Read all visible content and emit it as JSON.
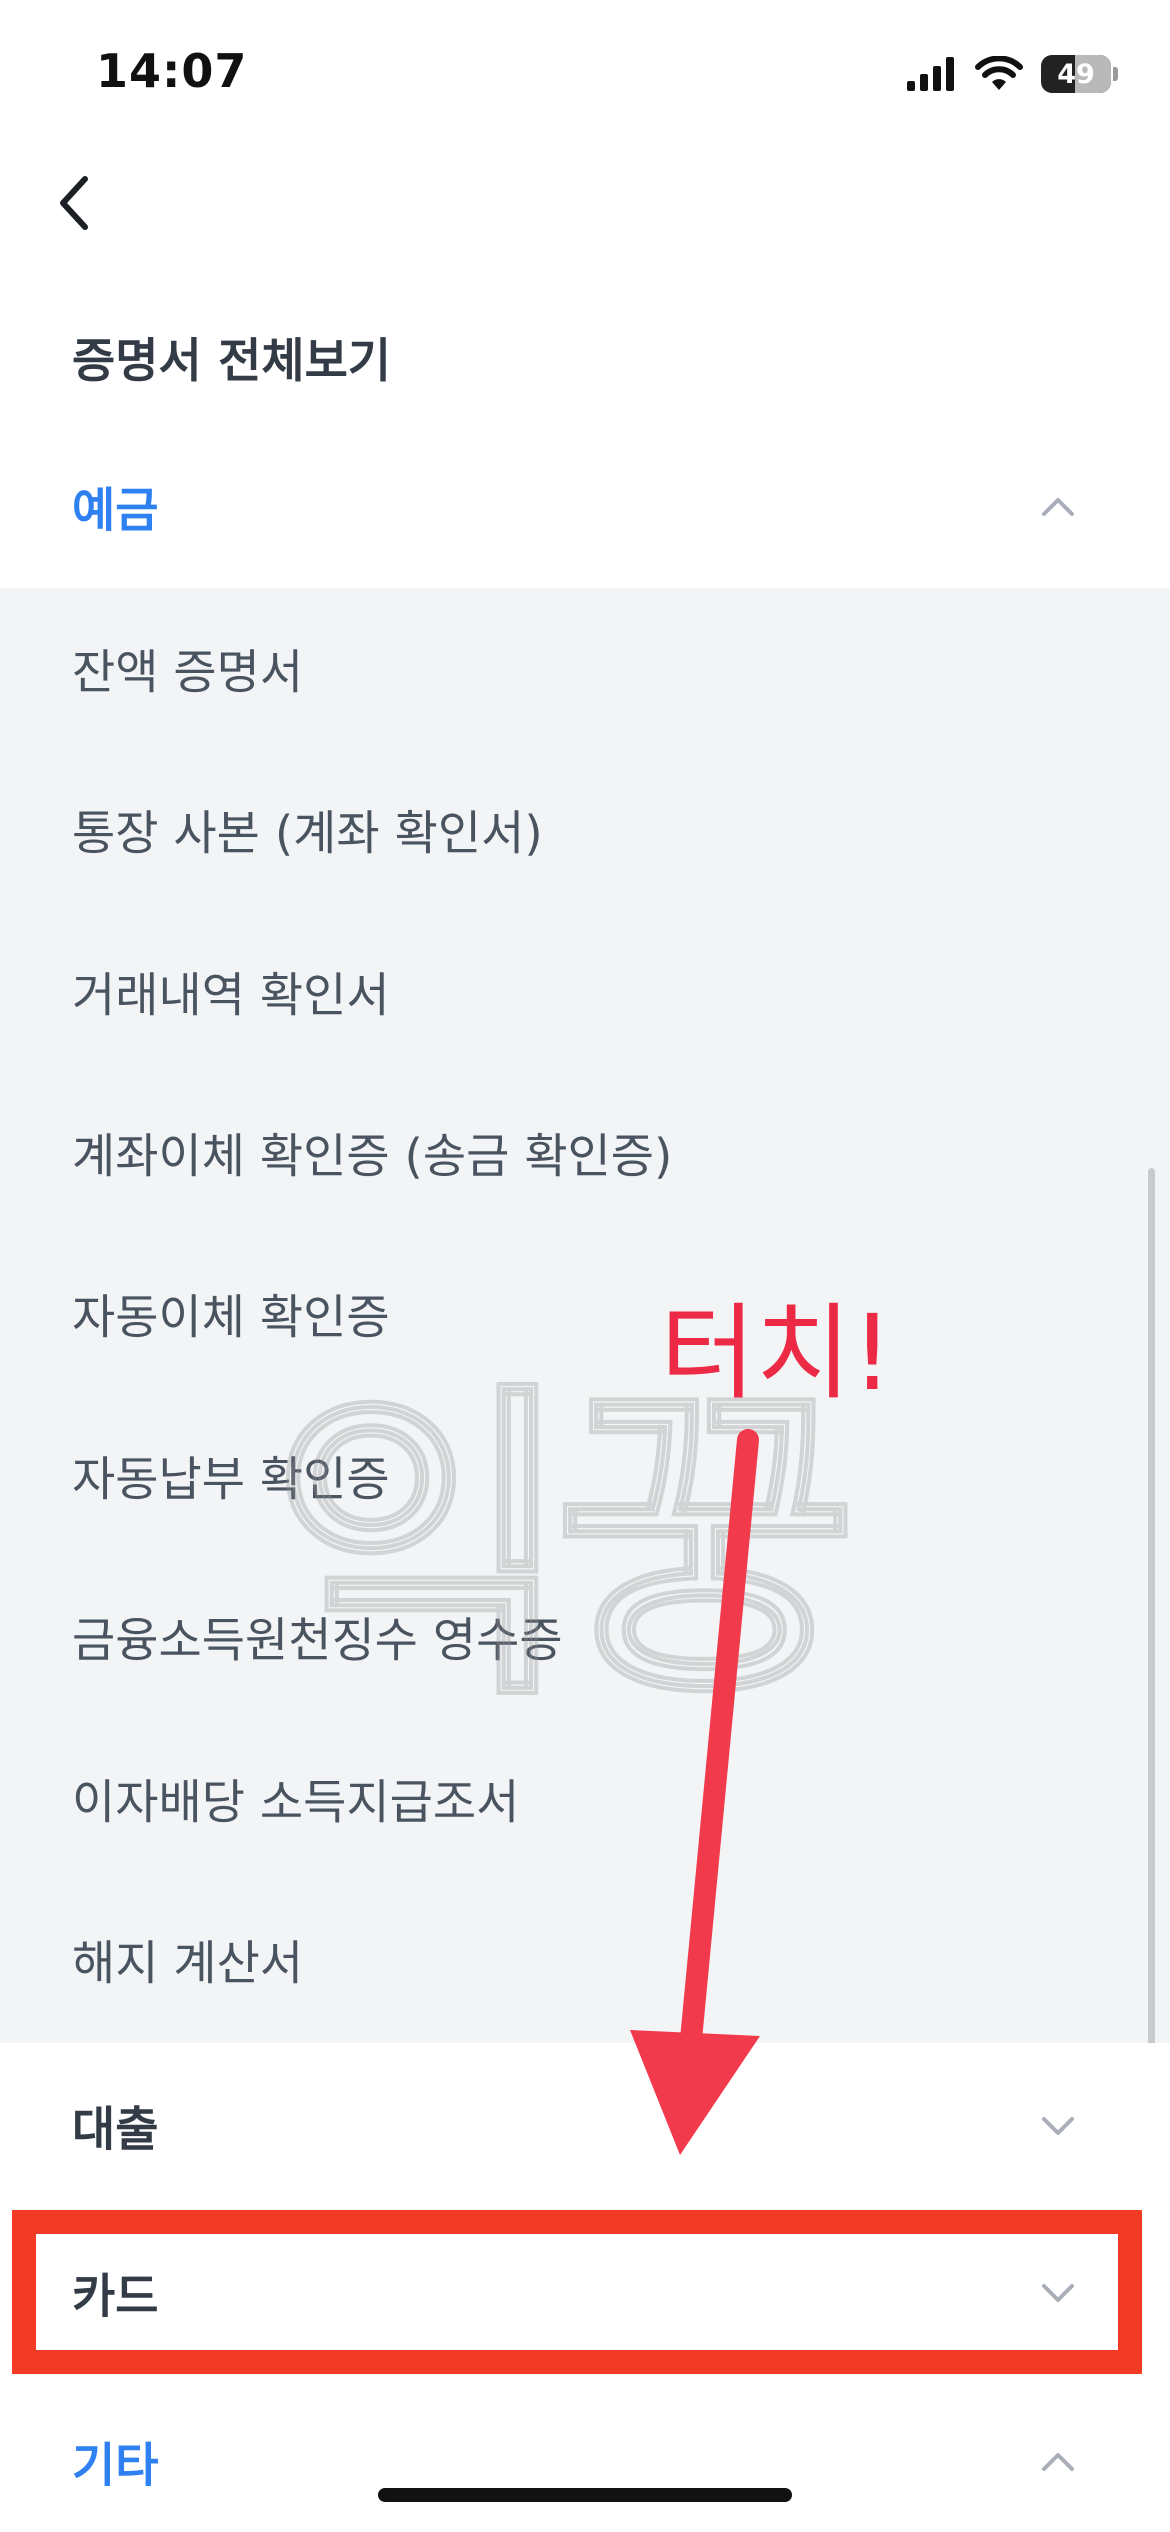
{
  "status_bar": {
    "time": "14:07",
    "battery_percent": 49,
    "battery_label": "49"
  },
  "header": {
    "title": "증명서 전체보기"
  },
  "sections": [
    {
      "label": "예금",
      "expanded": true,
      "items": [
        "잔액 증명서",
        "통장 사본 (계좌 확인서)",
        "거래내역 확인서",
        "계좌이체 확인증 (송금 확인증)",
        "자동이체 확인증",
        "자동납부 확인증",
        "금융소득원천징수 영수증",
        "이자배당 소득지급조서",
        "해지 계산서"
      ]
    },
    {
      "label": "대출",
      "expanded": false
    },
    {
      "label": "카드",
      "expanded": false
    },
    {
      "label": "기타",
      "expanded": true
    }
  ],
  "annotation": {
    "text": "터치!",
    "color": "#ec2a45",
    "highlight_color": "#f23a25"
  },
  "watermark": {
    "text": "익꿍"
  },
  "colors": {
    "accent": "#2f80f0",
    "list_background": "#f2f4f6",
    "text": "#333b46"
  }
}
